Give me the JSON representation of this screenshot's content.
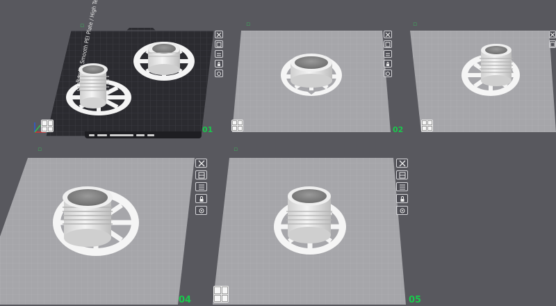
{
  "plates": [
    {
      "id": "plate-1",
      "number": "01",
      "label": "Bambu Smooth PEI Plate / High Temp Plate",
      "active": true,
      "objects": 2
    },
    {
      "id": "plate-2",
      "number": "02",
      "active": false,
      "objects": 1
    },
    {
      "id": "plate-3",
      "number": "",
      "active": false,
      "objects": 1
    },
    {
      "id": "plate-4",
      "number": "04",
      "active": false,
      "objects": 1
    },
    {
      "id": "plate-5",
      "number": "05",
      "active": false,
      "objects": 1
    }
  ],
  "plate_toolbar_icons": [
    "close-icon",
    "arrange-icon",
    "orient-icon",
    "lock-icon",
    "settings-icon"
  ],
  "colors": {
    "background": "#58585e",
    "plate": "#a6a6aa",
    "active_plate": "#2b2b30",
    "model": "#f2f2f2",
    "plate_number": "#19c94c"
  }
}
